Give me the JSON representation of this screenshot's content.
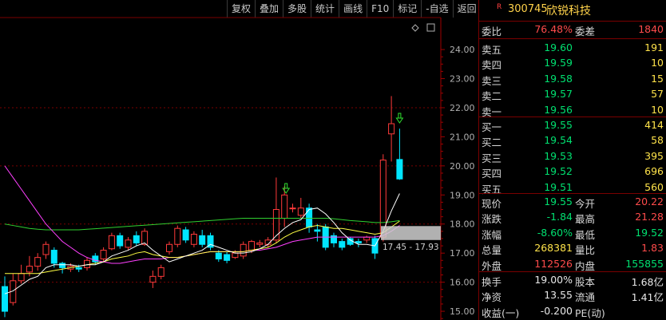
{
  "toolbar": [
    "复权",
    "叠加",
    "多股",
    "统计",
    "画线",
    "F10",
    "标记",
    "-自选",
    "返回"
  ],
  "chart": {
    "y_axis_labels": [
      "24.00",
      "23.00",
      "22.00",
      "21.00",
      "20.00",
      "19.00",
      "18.00",
      "17.00",
      "16.00",
      "15.00"
    ],
    "range_label": "17.45 - 17.93",
    "colors": {
      "up": "#ff3a3a",
      "down": "#00e5ff",
      "ma5": "#ffffff",
      "ma10": "#ffff44",
      "ma20": "#ff40ff",
      "ma60": "#30d030",
      "axis": "#a00000"
    }
  },
  "stock": {
    "badge": "R",
    "code": "300745",
    "name": "欣锐科技"
  },
  "ratio": {
    "wb_label": "委比",
    "wb_value": "76.48%",
    "wc_label": "委差",
    "wc_value": "1840"
  },
  "asks": [
    {
      "label": "卖五",
      "price": "19.60",
      "vol": "191"
    },
    {
      "label": "卖四",
      "price": "19.59",
      "vol": "10"
    },
    {
      "label": "卖三",
      "price": "19.58",
      "vol": "15"
    },
    {
      "label": "卖二",
      "price": "19.57",
      "vol": "57"
    },
    {
      "label": "卖一",
      "price": "19.56",
      "vol": "10"
    }
  ],
  "bids": [
    {
      "label": "买一",
      "price": "19.55",
      "vol": "414"
    },
    {
      "label": "买二",
      "price": "19.54",
      "vol": "58"
    },
    {
      "label": "买三",
      "price": "19.53",
      "vol": "395"
    },
    {
      "label": "买四",
      "price": "19.52",
      "vol": "696"
    },
    {
      "label": "买五",
      "price": "19.51",
      "vol": "560"
    }
  ],
  "quote": [
    {
      "l1": "现价",
      "v1": "19.55",
      "l2": "今开",
      "v2": "20.22"
    },
    {
      "l1": "涨跌",
      "v1": "-1.84",
      "l2": "最高",
      "v2": "21.28"
    },
    {
      "l1": "涨幅",
      "v1": "-8.60%",
      "l2": "最低",
      "v2": "19.52"
    },
    {
      "l1": "总量",
      "v1": "268381",
      "l2": "量比",
      "v2": "1.83"
    },
    {
      "l1": "外盘",
      "v1": "112526",
      "l2": "内盘",
      "v2": "155855"
    }
  ],
  "fundamentals": [
    {
      "l1": "换手",
      "v1": "19.00%",
      "l2": "股本",
      "v2": "1.68亿"
    },
    {
      "l1": "净资",
      "v1": "13.55",
      "l2": "流通",
      "v2": "1.41亿"
    },
    {
      "l1": "收益(一)",
      "v1": "-0.200",
      "l2": "PE(动)",
      "v2": ""
    }
  ],
  "chart_data": {
    "type": "candlestick",
    "candles": [
      {
        "o": 15.85,
        "c": 15.0,
        "h": 16.2,
        "l": 14.8
      },
      {
        "o": 15.3,
        "c": 16.05,
        "h": 16.3,
        "l": 15.2
      },
      {
        "o": 16.05,
        "c": 16.3,
        "h": 16.6,
        "l": 15.95
      },
      {
        "o": 16.35,
        "c": 16.55,
        "h": 16.9,
        "l": 16.2
      },
      {
        "o": 16.55,
        "c": 16.85,
        "h": 17.0,
        "l": 16.4
      },
      {
        "o": 16.95,
        "c": 17.3,
        "h": 17.4,
        "l": 16.8
      },
      {
        "o": 17.1,
        "c": 16.65,
        "h": 17.2,
        "l": 16.5
      },
      {
        "o": 16.65,
        "c": 16.5,
        "h": 16.7,
        "l": 16.3
      },
      {
        "o": 16.45,
        "c": 16.55,
        "h": 16.65,
        "l": 16.35
      },
      {
        "o": 16.5,
        "c": 16.45,
        "h": 16.6,
        "l": 16.35
      },
      {
        "o": 16.5,
        "c": 16.75,
        "h": 16.85,
        "l": 16.4
      },
      {
        "o": 16.9,
        "c": 16.7,
        "h": 17.0,
        "l": 16.6
      },
      {
        "o": 16.8,
        "c": 17.1,
        "h": 17.2,
        "l": 16.7
      },
      {
        "o": 17.15,
        "c": 17.6,
        "h": 17.7,
        "l": 17.1
      },
      {
        "o": 17.6,
        "c": 17.25,
        "h": 17.7,
        "l": 17.15
      },
      {
        "o": 17.2,
        "c": 17.45,
        "h": 17.55,
        "l": 17.1
      },
      {
        "o": 17.6,
        "c": 17.35,
        "h": 17.75,
        "l": 17.25
      },
      {
        "o": 17.3,
        "c": 17.75,
        "h": 17.85,
        "l": 17.25
      },
      {
        "o": 16.0,
        "c": 16.2,
        "h": 16.4,
        "l": 15.8
      },
      {
        "o": 16.2,
        "c": 16.5,
        "h": 16.6,
        "l": 16.1
      },
      {
        "o": 17.05,
        "c": 17.3,
        "h": 17.4,
        "l": 16.95
      },
      {
        "o": 17.3,
        "c": 17.85,
        "h": 17.95,
        "l": 17.2
      },
      {
        "o": 17.8,
        "c": 17.45,
        "h": 17.9,
        "l": 17.35
      },
      {
        "o": 17.3,
        "c": 17.65,
        "h": 17.75,
        "l": 17.2
      },
      {
        "o": 17.6,
        "c": 17.3,
        "h": 17.8,
        "l": 17.2
      },
      {
        "o": 17.6,
        "c": 17.2,
        "h": 17.7,
        "l": 17.1
      },
      {
        "o": 17.0,
        "c": 16.8,
        "h": 17.1,
        "l": 16.7
      },
      {
        "o": 16.95,
        "c": 16.75,
        "h": 17.05,
        "l": 16.65
      },
      {
        "o": 16.85,
        "c": 17.0,
        "h": 17.1,
        "l": 16.8
      },
      {
        "o": 16.9,
        "c": 17.3,
        "h": 17.4,
        "l": 16.8
      },
      {
        "o": 17.1,
        "c": 17.4,
        "h": 17.45,
        "l": 17.0
      },
      {
        "o": 17.3,
        "c": 17.35,
        "h": 17.45,
        "l": 17.2
      },
      {
        "o": 17.3,
        "c": 17.45,
        "h": 17.55,
        "l": 17.2
      },
      {
        "o": 17.45,
        "c": 18.5,
        "h": 19.6,
        "l": 17.35
      },
      {
        "o": 18.2,
        "c": 19.0,
        "h": 19.3,
        "l": 17.9
      },
      {
        "o": 18.55,
        "c": 18.55,
        "h": 18.7,
        "l": 18.4
      },
      {
        "o": 18.3,
        "c": 18.55,
        "h": 18.9,
        "l": 18.2
      },
      {
        "o": 18.55,
        "c": 17.9,
        "h": 18.7,
        "l": 17.7
      },
      {
        "o": 17.8,
        "c": 17.75,
        "h": 18.0,
        "l": 17.4
      },
      {
        "o": 17.9,
        "c": 17.2,
        "h": 18.0,
        "l": 17.1
      },
      {
        "o": 17.6,
        "c": 17.35,
        "h": 17.7,
        "l": 17.2
      },
      {
        "o": 17.4,
        "c": 17.2,
        "h": 17.5,
        "l": 17.1
      },
      {
        "o": 17.5,
        "c": 17.3,
        "h": 17.55,
        "l": 17.25
      },
      {
        "o": 17.4,
        "c": 17.35,
        "h": 17.5,
        "l": 17.2
      },
      {
        "o": 17.45,
        "c": 17.55,
        "h": 17.6,
        "l": 17.35
      },
      {
        "o": 17.5,
        "c": 17.0,
        "h": 17.6,
        "l": 16.8
      },
      {
        "o": 17.55,
        "c": 20.2,
        "h": 20.4,
        "l": 17.4
      },
      {
        "o": 21.1,
        "c": 21.45,
        "h": 22.4,
        "l": 20.15
      },
      {
        "o": 20.22,
        "c": 19.55,
        "h": 21.28,
        "l": 19.52
      }
    ],
    "ma5": [
      15.6,
      15.7,
      15.9,
      16.1,
      16.2,
      16.5,
      16.6,
      16.6,
      16.6,
      16.55,
      16.6,
      16.6,
      16.7,
      16.9,
      17.0,
      17.1,
      17.25,
      17.35,
      17.1,
      16.9,
      16.7,
      16.8,
      16.9,
      17.0,
      17.1,
      17.3,
      17.2,
      17.1,
      17.0,
      17.0,
      17.05,
      17.15,
      17.3,
      17.6,
      17.85,
      18.05,
      18.15,
      18.5,
      18.55,
      18.35,
      18.05,
      17.7,
      17.45,
      17.3,
      17.3,
      17.25,
      17.75,
      18.45,
      19.05
    ],
    "ma10": [
      16.3,
      16.3,
      16.3,
      16.3,
      16.3,
      16.35,
      16.4,
      16.45,
      16.5,
      16.55,
      16.6,
      16.65,
      16.7,
      16.8,
      16.85,
      16.9,
      17.0,
      17.05,
      16.95,
      16.9,
      16.85,
      16.85,
      16.9,
      16.95,
      17.0,
      17.05,
      17.05,
      17.05,
      17.05,
      17.05,
      17.1,
      17.15,
      17.2,
      17.35,
      17.55,
      17.7,
      17.8,
      17.9,
      17.95,
      17.9,
      17.85,
      17.85,
      17.8,
      17.75,
      17.7,
      17.65,
      17.7,
      17.9,
      18.1
    ],
    "ma20": [
      20.0,
      19.6,
      19.2,
      18.8,
      18.4,
      18.0,
      17.7,
      17.4,
      17.2,
      17.0,
      16.85,
      16.75,
      16.7,
      16.65,
      16.65,
      16.7,
      16.75,
      16.8,
      16.8,
      16.8,
      16.85,
      16.85,
      16.9,
      16.95,
      17.0,
      17.05,
      17.05,
      17.05,
      17.05,
      17.05,
      17.1,
      17.1,
      17.15,
      17.2,
      17.3,
      17.4,
      17.45,
      17.5,
      17.55,
      17.55,
      17.55,
      17.55,
      17.55,
      17.55,
      17.55,
      17.55,
      17.6,
      17.75,
      17.95
    ],
    "ma60": [
      18.0,
      17.95,
      17.9,
      17.85,
      17.82,
      17.8,
      17.8,
      17.8,
      17.8,
      17.8,
      17.82,
      17.84,
      17.86,
      17.88,
      17.9,
      17.92,
      17.94,
      17.96,
      17.98,
      18.0,
      18.02,
      18.04,
      18.06,
      18.08,
      18.1,
      18.12,
      18.14,
      18.16,
      18.18,
      18.2,
      18.2,
      18.2,
      18.2,
      18.2,
      18.2,
      18.2,
      18.2,
      18.2,
      18.2,
      18.2,
      18.18,
      18.15,
      18.12,
      18.1,
      18.08,
      18.05,
      18.05,
      18.08,
      18.12
    ],
    "y_range": [
      14.7,
      25.1
    ]
  }
}
